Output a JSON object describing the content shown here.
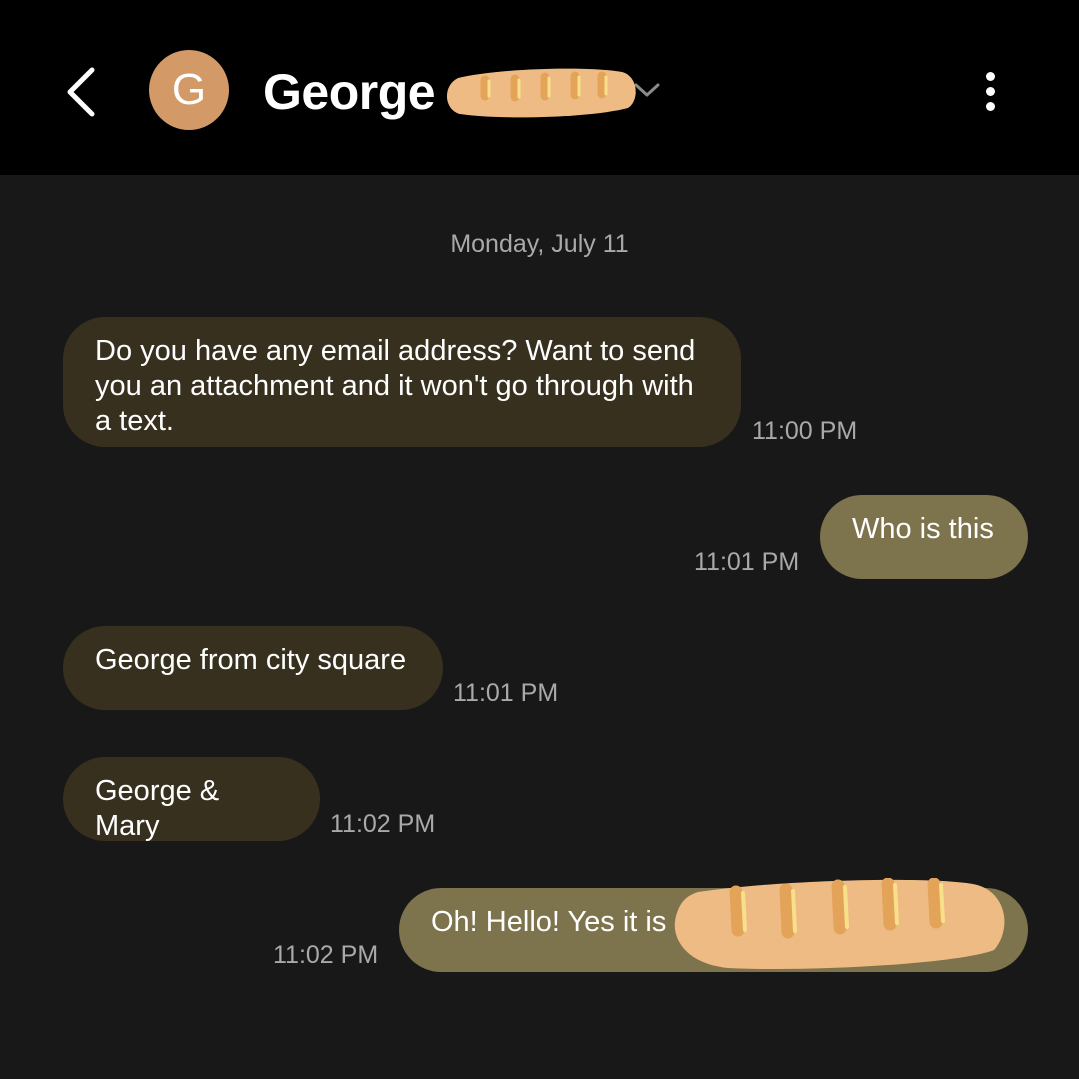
{
  "header": {
    "contact_name": "George",
    "avatar_initial": "G",
    "back_icon": "chevron-left-icon",
    "expand_icon": "chevron-down-icon",
    "more_icon": "more-vertical-icon"
  },
  "conversation": {
    "date_separator": "Monday, July 11",
    "messages": [
      {
        "direction": "incoming",
        "text": "Do you have any email address? Want to send you an attachment and it won't go through with a text.",
        "time": "11:00 PM"
      },
      {
        "direction": "outgoing",
        "text": "Who is this",
        "time": "11:01 PM"
      },
      {
        "direction": "incoming",
        "text": "George from city square",
        "time": "11:01 PM"
      },
      {
        "direction": "incoming",
        "text": "George & Mary",
        "time": "11:02 PM"
      },
      {
        "direction": "outgoing",
        "text": "Oh! Hello! Yes it is",
        "time": "11:02 PM"
      }
    ]
  },
  "colors": {
    "header_bg": "#000000",
    "screen_bg": "#181818",
    "incoming_bubble": "#37301f",
    "outgoing_bubble": "#7d734d",
    "avatar": "#d39a67",
    "timestamp": "#a9a9a9"
  }
}
